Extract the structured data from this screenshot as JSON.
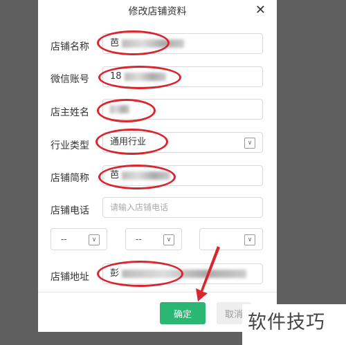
{
  "dialog": {
    "title": "修改店铺资料",
    "close_symbol": "✕",
    "fields": [
      {
        "label": "店铺名称",
        "value": "芭"
      },
      {
        "label": "微信账号",
        "value": "18"
      },
      {
        "label": "店主姓名",
        "value": ""
      },
      {
        "label": "行业类型",
        "value": "通用行业"
      },
      {
        "label": "店铺简称",
        "value": "芭"
      },
      {
        "label": "店铺电话",
        "placeholder": "请输入店铺电话"
      },
      {
        "label": "店铺地址",
        "value": "彭"
      }
    ],
    "region_selects": [
      {
        "value": "--"
      },
      {
        "value": "--"
      },
      {
        "value": ""
      }
    ],
    "confirm_label": "确定",
    "cancel_label": "取消"
  },
  "watermark": "软件技巧",
  "colors": {
    "overlay": "#5f5f5f",
    "confirm_button": "#2bb673",
    "annotation": "#d9262e"
  }
}
